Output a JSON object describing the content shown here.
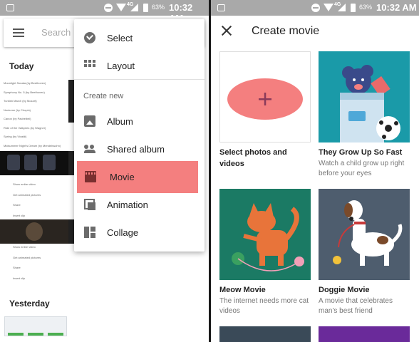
{
  "status_bar": {
    "network": "4G",
    "battery": "63%",
    "time": "10:32 AM"
  },
  "left": {
    "search_placeholder": "Search",
    "today_label": "Today",
    "yesterday_label": "Yesterday",
    "track_list": [
      "Moonlight Sonata (by Beethoven)",
      "Symphony No. 5 (by Beethoven)",
      "Turkish March (by Mozart)",
      "Nocturne (by Chopin)",
      "Canon (by Pachelbel)",
      "Ride of the Valkyries (by Wagner)",
      "Spring (by Vivaldi)",
      "Midsummer Night's Dream (by Mendelssohn)"
    ],
    "media_rows_a": [
      "Show entire video",
      "Get animated pictures",
      "Share",
      "Insert clip"
    ],
    "media_rows_b": [
      "Show entire video",
      "Get animated pictures",
      "Share",
      "Insert clip"
    ],
    "menu": {
      "items_top": [
        {
          "label": "Select",
          "icon": "check-circle-icon"
        },
        {
          "label": "Layout",
          "icon": "grid-icon"
        }
      ],
      "create_new_header": "Create new",
      "items_create": [
        {
          "label": "Album",
          "icon": "photo-album-icon"
        },
        {
          "label": "Shared album",
          "icon": "people-icon"
        },
        {
          "label": "Movie",
          "icon": "movie-icon",
          "highlighted": true
        },
        {
          "label": "Animation",
          "icon": "animation-icon"
        },
        {
          "label": "Collage",
          "icon": "collage-icon"
        }
      ],
      "highlight_color": "#f47f7f"
    }
  },
  "right": {
    "title": "Create movie",
    "tiles": [
      {
        "title": "Select photos and videos",
        "subtitle": "",
        "icon": "plus-icon"
      },
      {
        "title": "They Grow Up So Fast",
        "subtitle": "Watch a child grow up right before your eyes"
      },
      {
        "title": "Meow Movie",
        "subtitle": "The internet needs more cat videos"
      },
      {
        "title": "Doggie Movie",
        "subtitle": "A movie that celebrates man's best friend"
      }
    ],
    "colors": {
      "tile_teal": "#1a9aa8",
      "tile_green": "#1b7a64",
      "tile_slate": "#4e5d6e",
      "plus_oval": "#f47f7f"
    }
  }
}
